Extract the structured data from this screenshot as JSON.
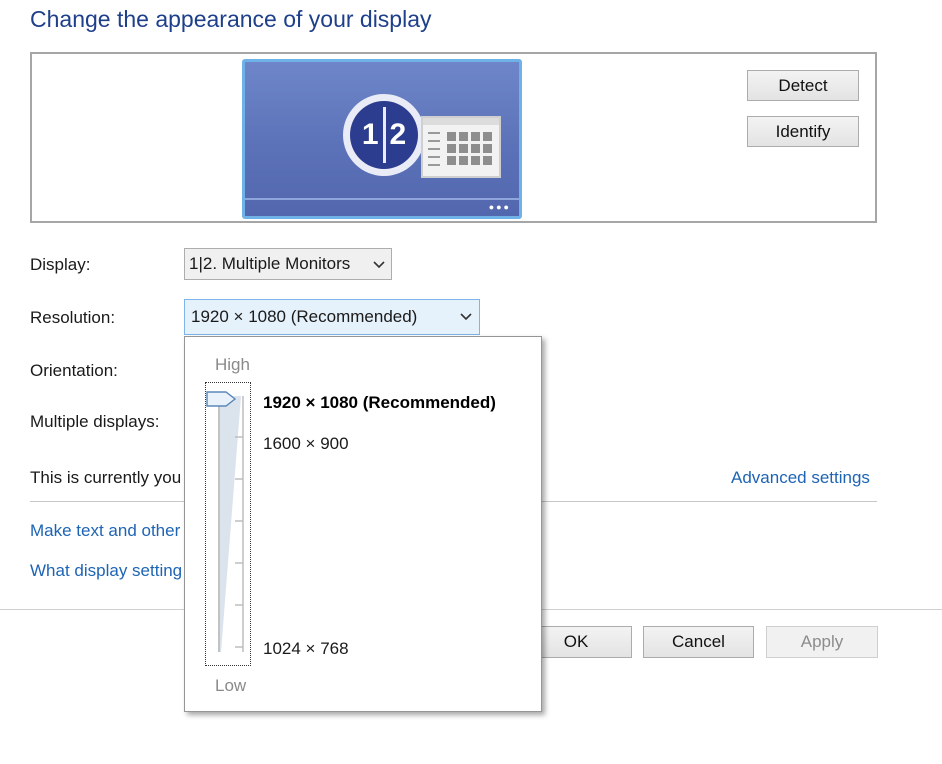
{
  "title": "Change the appearance of your display",
  "preview": {
    "monitor_badge": [
      "1",
      "2"
    ],
    "detect_label": "Detect",
    "identify_label": "Identify"
  },
  "display": {
    "label": "Display:",
    "value": "1|2. Multiple Monitors"
  },
  "resolution": {
    "label": "Resolution:",
    "value": "1920 × 1080 (Recommended)",
    "popup": {
      "high_label": "High",
      "low_label": "Low",
      "options": [
        "1920 × 1080 (Recommended)",
        "1600 × 900",
        "1024 × 768"
      ],
      "selected_index": 0
    }
  },
  "orientation": {
    "label": "Orientation:"
  },
  "multiple_displays": {
    "label": "Multiple displays:"
  },
  "current_text": "This is currently you",
  "advanced_link": "Advanced settings",
  "links": [
    "Make text and other",
    "What display setting"
  ],
  "buttons": {
    "ok": "OK",
    "cancel": "Cancel",
    "apply": "Apply"
  },
  "colors": {
    "title": "#1e3f8a",
    "link": "#1e64b4",
    "monitor": "#5c72b8",
    "badge": "#2c3c8e"
  }
}
